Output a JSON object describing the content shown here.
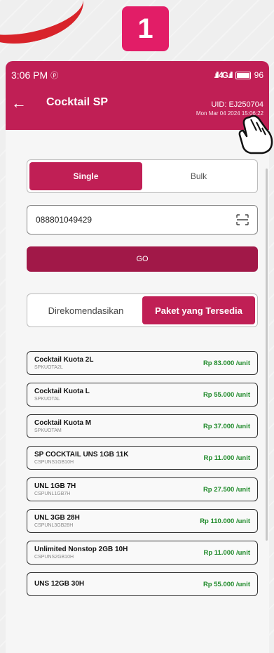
{
  "step": {
    "number": "1"
  },
  "status_bar": {
    "time": "3:06 PM",
    "signal": ".ıll 4G .ıll",
    "battery": "96"
  },
  "header": {
    "title": "Cocktail SP",
    "uid": "UID: EJ250704",
    "datetime": "Mon Mar 04 2024 15:06:22"
  },
  "mode_toggle": {
    "single": "Single",
    "bulk": "Bulk",
    "selected": "Single"
  },
  "msisdn": {
    "value": "088801049429"
  },
  "go_button": {
    "label": "GO"
  },
  "tabs": {
    "recommended": "Direkomendasikan",
    "available": "Paket yang Tersedia",
    "selected": "Paket yang Tersedia"
  },
  "packages": [
    {
      "name": "Cocktail Kuota 2L",
      "code": "SPKUOTA2L",
      "price": "Rp 83.000 /unit"
    },
    {
      "name": "Cocktail Kuota L",
      "code": "SPKUOTAL",
      "price": "Rp 55.000 /unit"
    },
    {
      "name": "Cocktail Kuota M",
      "code": "SPKUOTAM",
      "price": "Rp 37.000 /unit"
    },
    {
      "name": "SP COCKTAIL UNS 1GB 11K",
      "code": "CSPUNS1GB10H",
      "price": "Rp 11.000 /unit"
    },
    {
      "name": "UNL 1GB 7H",
      "code": "CSPUNL1GB7H",
      "price": "Rp 27.500 /unit"
    },
    {
      "name": "UNL 3GB 28H",
      "code": "CSPUNL3GB28H",
      "price": "Rp 110.000 /unit"
    },
    {
      "name": "Unlimited Nonstop 2GB 10H",
      "code": "CSPUNS2GB10H",
      "price": "Rp 11.000 /unit"
    },
    {
      "name": "UNS 12GB 30H",
      "code": "",
      "price": "Rp 55.000 /unit"
    }
  ],
  "colors": {
    "brand": "#c01f55",
    "price": "#1f8a2a",
    "badge": "#e21d67"
  }
}
